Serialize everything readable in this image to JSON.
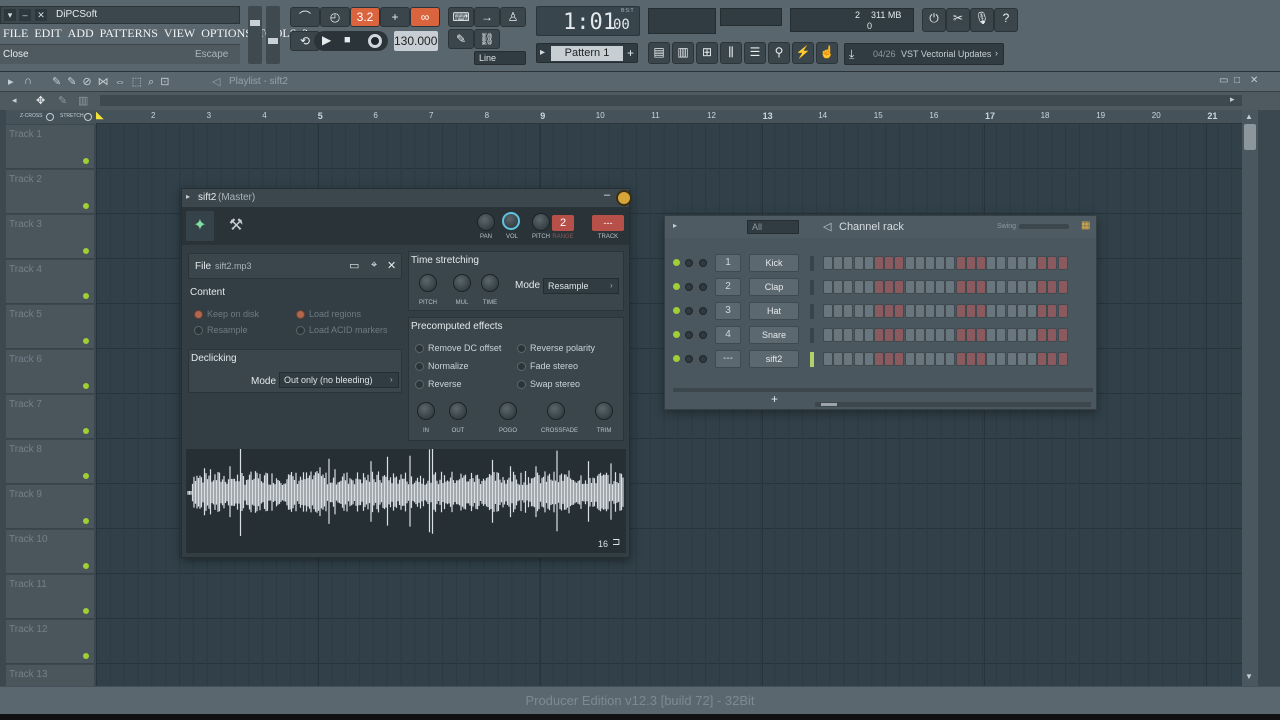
{
  "window": {
    "title": "DiPCSoft"
  },
  "menu": [
    "FILE",
    "EDIT",
    "ADD",
    "PATTERNS",
    "VIEW",
    "OPTIONS",
    "TOOLS",
    "?"
  ],
  "hint": {
    "left": "Close",
    "right": "Escape"
  },
  "transport": {
    "time": "1:01",
    "time_small": "00",
    "time_label": "B:S:T",
    "bpm": "130.000",
    "pattern": "Pattern 1",
    "snap": "Line"
  },
  "cpu": {
    "voices": "2",
    "memory": "311 MB",
    "cpu_value": "0"
  },
  "news": {
    "count": "04/26",
    "text": "VST Vectorial Updates"
  },
  "playlist": {
    "title": "Playlist - sift2",
    "zcross": "Z-CROSS",
    "stretch": "STRETCH",
    "tracks": [
      "Track 1",
      "Track 2",
      "Track 3",
      "Track 4",
      "Track 5",
      "Track 6",
      "Track 7",
      "Track 8",
      "Track 9",
      "Track 10",
      "Track 11",
      "Track 12",
      "Track 13"
    ],
    "bars": [
      "2",
      "3",
      "4",
      "5",
      "6",
      "7",
      "8",
      "9",
      "10",
      "11",
      "12",
      "13",
      "14",
      "15",
      "16",
      "17",
      "18",
      "19",
      "20",
      "21"
    ]
  },
  "sampler": {
    "title": "sift2",
    "subtitle": "(Master)",
    "file_label": "File",
    "file_name": "sift2.mp3",
    "top_knobs": [
      "PAN",
      "VOL",
      "PITCH",
      "RANGE",
      "TRACK"
    ],
    "range_value": "2",
    "track_value": "---",
    "content": {
      "heading": "Content",
      "options": [
        "Keep on disk",
        "Load regions",
        "Resample",
        "Load ACID markers"
      ]
    },
    "declicking": {
      "heading": "Declicking",
      "mode_label": "Mode",
      "mode_value": "Out only (no bleeding)"
    },
    "stretch": {
      "heading": "Time stretching",
      "knobs": [
        "PITCH",
        "MUL",
        "TIME"
      ],
      "mode_label": "Mode",
      "mode_value": "Resample"
    },
    "effects": {
      "heading": "Precomputed effects",
      "options": [
        "Remove DC offset",
        "Reverse polarity",
        "Normalize",
        "Fade stereo",
        "Reverse",
        "Swap stereo"
      ],
      "knobs": [
        "IN",
        "OUT",
        "POGO",
        "CROSSFADE",
        "TRIM"
      ]
    },
    "wave_bits": "16"
  },
  "rack": {
    "title": "Channel rack",
    "filter": "All",
    "swing": "Swing",
    "add": "+",
    "channels": [
      {
        "num": "1",
        "name": "Kick"
      },
      {
        "num": "2",
        "name": "Clap"
      },
      {
        "num": "3",
        "name": "Hat"
      },
      {
        "num": "4",
        "name": "Snare"
      },
      {
        "num": "---",
        "name": "sift2"
      }
    ]
  },
  "status": "Producer Edition v12.3 [build 72] - 32Bit"
}
